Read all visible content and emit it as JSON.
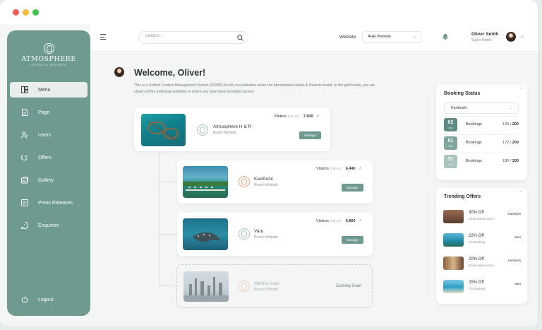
{
  "sidebar": {
    "brand": "ATMOSPHERE",
    "brand_sub": "HOTELS & RESORTS",
    "items": [
      {
        "label": "Menu",
        "icon": "menu-grid-icon"
      },
      {
        "label": "Page",
        "icon": "page-icon"
      },
      {
        "label": "Users",
        "icon": "users-icon"
      },
      {
        "label": "Offers",
        "icon": "offers-icon"
      },
      {
        "label": "Gallery",
        "icon": "gallery-icon"
      },
      {
        "label": "Press Releases",
        "icon": "press-icon"
      },
      {
        "label": "Enquiries",
        "icon": "enquiries-icon"
      }
    ],
    "logout": "Logout"
  },
  "header": {
    "search_placeholder": "Search...",
    "website_label": "Website",
    "website_value": "AHR Website",
    "user_name": "Oliver Smith",
    "user_role": "Super Admin"
  },
  "main": {
    "welcome": "Welcome, Oliver!",
    "description": "This is a Unified Content Management Sysem (UCMS) for all your websites under the Atmosphere Hotels & Resorts brand. In the grid below, you are shown all the individual websites to which you have been provided access.",
    "sites": [
      {
        "name": "Atmosphere H & R",
        "type": "Brand Website",
        "visitors_label": "Visitors",
        "period": "(Feb 01)",
        "visitors": "7,000",
        "action": "Manage"
      },
      {
        "name": "Kanifushi",
        "type": "Resort Website",
        "visitors_label": "Visitors",
        "period": "(Feb 01)",
        "visitors": "6,440",
        "action": "Manage"
      },
      {
        "name": "Varu",
        "type": "Resort Website",
        "visitors_label": "Visitors",
        "period": "(Feb 01)",
        "visitors": "6,800",
        "action": "Manage"
      },
      {
        "name": "Marina Gate",
        "type": "Resort Website",
        "status": "Coming Soon"
      }
    ]
  },
  "booking_status": {
    "title": "Booking Status",
    "select_value": "Kanifushi",
    "rows": [
      {
        "day": "02",
        "month": "FEB",
        "label": "Bookings",
        "count": "130",
        "total": "200",
        "color": "#5e8b83"
      },
      {
        "day": "01",
        "month": "FEB",
        "label": "Bookings",
        "count": "172",
        "total": "200",
        "color": "#7ea59e"
      },
      {
        "day": "31",
        "month": "JAN",
        "label": "Bookings",
        "count": "186",
        "total": "200",
        "color": "#a9c4bf"
      }
    ]
  },
  "trending_offers": {
    "title": "Trending Offers",
    "items": [
      {
        "pct": "30% Off",
        "desc": "Book lowest price..",
        "site": "Kanifushi"
      },
      {
        "pct": "22% Off",
        "desc": "On Booking",
        "site": "Varu"
      },
      {
        "pct": "20% Off",
        "desc": "Book lowest price..",
        "site": "Kanifushi"
      },
      {
        "pct": "25% Off",
        "desc": "On Booking",
        "site": "Varu"
      }
    ]
  },
  "colors": {
    "accent": "#6e9a92",
    "trend_up": "#4aa08f"
  }
}
